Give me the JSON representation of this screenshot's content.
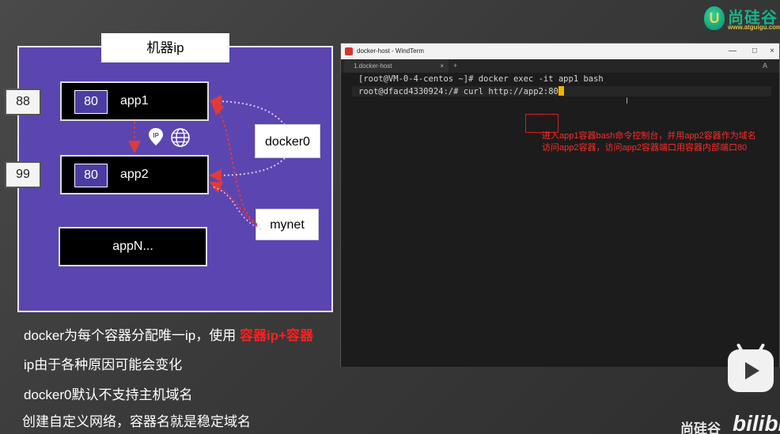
{
  "logo": {
    "badge_letter": "U",
    "brand": "尚硅谷",
    "url": "www.atguigu.com"
  },
  "diagram": {
    "host_title": "机器ip",
    "host_ports": [
      "88",
      "99"
    ],
    "apps": [
      {
        "port": "80",
        "name": "app1"
      },
      {
        "port": "80",
        "name": "app2"
      },
      {
        "name": "appN..."
      }
    ],
    "networks": [
      "docker0",
      "mynet"
    ],
    "link_icons": [
      "ip-pin-icon",
      "globe-icon"
    ]
  },
  "bullets": [
    {
      "text": "docker为每个容器分配唯一ip，使用 ",
      "highlight": "容器ip+容器"
    },
    {
      "text": "ip由于各种原因可能会变化"
    },
    {
      "text": "docker0默认不支持主机域名"
    },
    {
      "text": "创建自定义网络，容器名就是稳定域名"
    }
  ],
  "terminal": {
    "window_title": "docker-host - WindTerm",
    "tab_label": "1.docker-host",
    "tab_close": "×",
    "tab_add": "+",
    "tab_menu": "A",
    "window_buttons": [
      "—",
      "□",
      "×"
    ],
    "lines": [
      "[root@VM-0-4-centos ~]# docker exec -it app1 bash",
      "root@dfacd4330924:/# curl http://app2:80"
    ],
    "caret_glyph": "I",
    "notes": [
      "进入app1容器bash命令控制台，并用app2容器作为域名",
      "访问app2容器，访问app2容器端口用容器内部端口80"
    ]
  },
  "watermark": {
    "text": "尚硅谷",
    "bili": "bilibili"
  },
  "colors": {
    "diagram_bg": "#5b45b0",
    "highlight_red": "#ff2020",
    "arrow_red": "#e23a3a",
    "brand_green": "#13b58a"
  }
}
